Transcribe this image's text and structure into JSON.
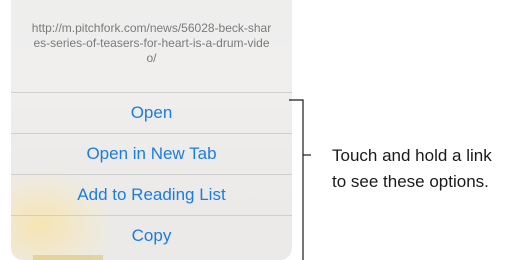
{
  "sheet": {
    "url": "http://m.pitchfork.com/news/56028-beck-shares-series-of-teasers-for-heart-is-a-drum-video/",
    "actions": [
      {
        "label": "Open"
      },
      {
        "label": "Open in New Tab"
      },
      {
        "label": "Add to Reading List"
      },
      {
        "label": "Copy"
      }
    ]
  },
  "callout": {
    "line1": "Touch and hold a link",
    "line2": "to see these options."
  },
  "colors": {
    "action_text": "#1a7de1",
    "url_text": "#7a7a7a"
  }
}
